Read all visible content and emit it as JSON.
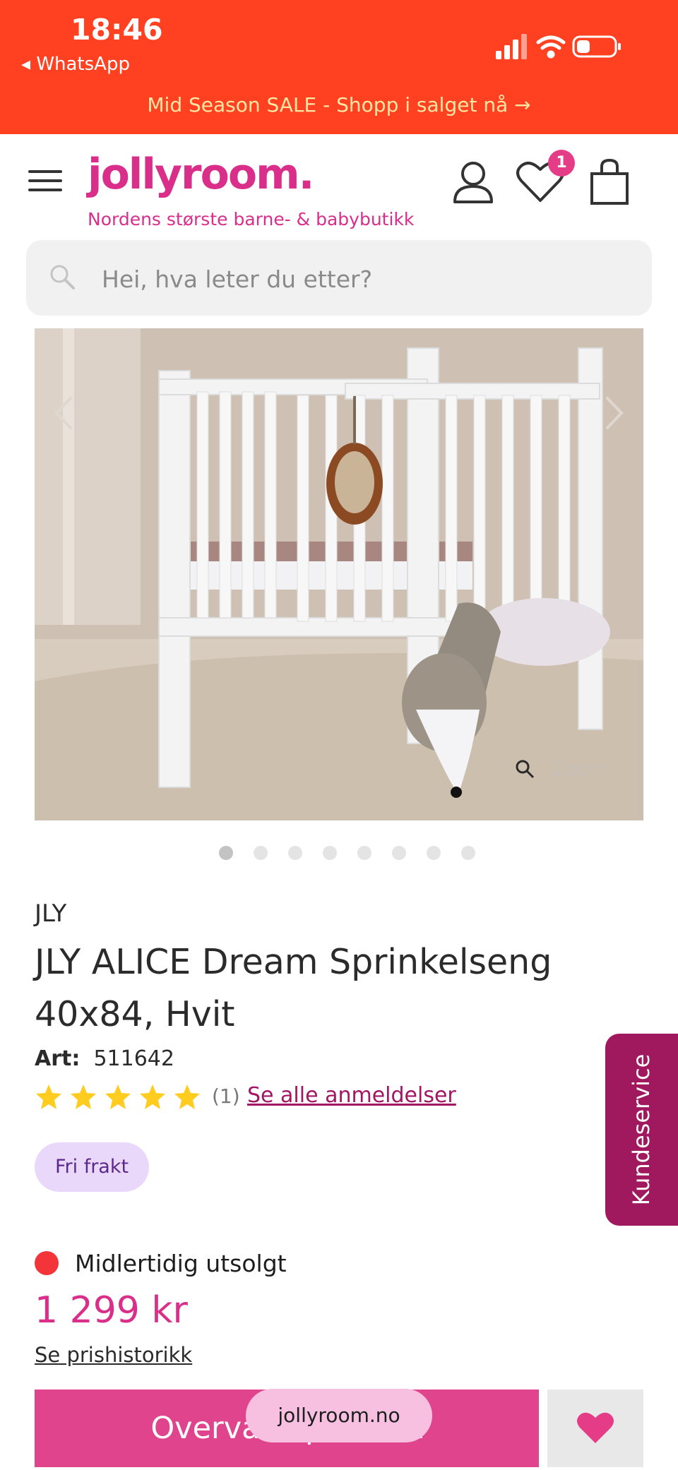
{
  "status_bar": {
    "time": "18:46",
    "back_app": "◂ WhatsApp"
  },
  "promo_banner": {
    "text": "Mid Season SALE - Shopp i salget nå →"
  },
  "header": {
    "logo": "jollyroom.",
    "tagline": "Nordens største barne- & babybutikk",
    "wishlist_count": "1"
  },
  "search": {
    "placeholder": "Hei, hva leter du etter?"
  },
  "gallery": {
    "zoom_label": "Zoom",
    "image_count": 8,
    "active_index": 0
  },
  "product": {
    "brand": "JLY",
    "title": "JLY ALICE Dream Sprinkelseng 40x84, Hvit",
    "art_label": "Art:",
    "art_number": "511642",
    "rating": 5,
    "review_count": "(1)",
    "reviews_link": "Se alle anmeldelser",
    "shipping_badge": "Fri frakt",
    "stock_status": "Midlertidig utsolgt",
    "price": "1 299 kr",
    "price_history_link": "Se prishistorikk",
    "watch_button": "Overvåke produkt"
  },
  "customer_service": {
    "label": "Kundeservice"
  },
  "browser": {
    "url": "jollyroom.no"
  },
  "colors": {
    "status_bar": "#ff4122",
    "brand_pink": "#d92e8a",
    "service_tab": "#a0185e",
    "out_of_stock": "#f33438",
    "star": "#ffcc1f"
  }
}
